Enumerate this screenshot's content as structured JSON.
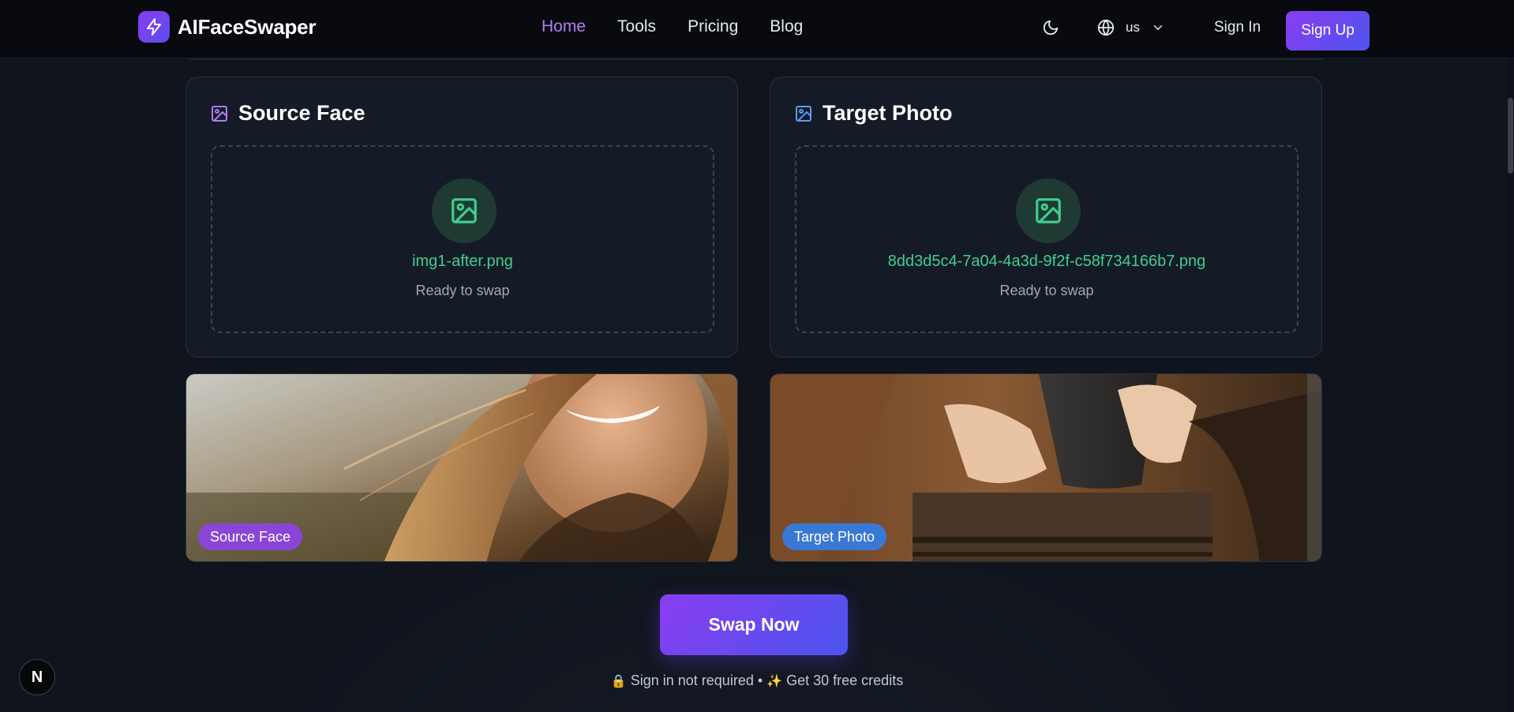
{
  "header": {
    "logo_text": "AIFaceSwaper",
    "nav": [
      {
        "label": "Home",
        "active": true
      },
      {
        "label": "Tools",
        "active": false
      },
      {
        "label": "Pricing",
        "active": false
      },
      {
        "label": "Blog",
        "active": false
      }
    ],
    "language": "us",
    "sign_in": "Sign In",
    "sign_up": "Sign Up"
  },
  "source_card": {
    "title": "Source Face",
    "filename": "img1-after.png",
    "status": "Ready to swap"
  },
  "target_card": {
    "title": "Target Photo",
    "filename": "8dd3d5c4-7a04-4a3d-9f2f-c58f734166b7.png",
    "status": "Ready to swap"
  },
  "previews": {
    "source_label": "Source Face",
    "target_label": "Target Photo"
  },
  "swap_button": "Swap Now",
  "note": {
    "part1": "Sign in not required",
    "separator": "•",
    "part2": "Get 30 free credits"
  },
  "corner_badge": "N",
  "colors": {
    "accent_purple": "#8b3cf0",
    "accent_blue": "#4a55ee",
    "nav_active": "#b07cf4",
    "success_green": "#3ecf8e",
    "background": "#0f141d"
  },
  "icons": {
    "logo": "lightning-icon",
    "theme": "moon-icon",
    "language": "globe-icon",
    "dropdown": "chevron-down-icon",
    "card": "image-icon"
  }
}
